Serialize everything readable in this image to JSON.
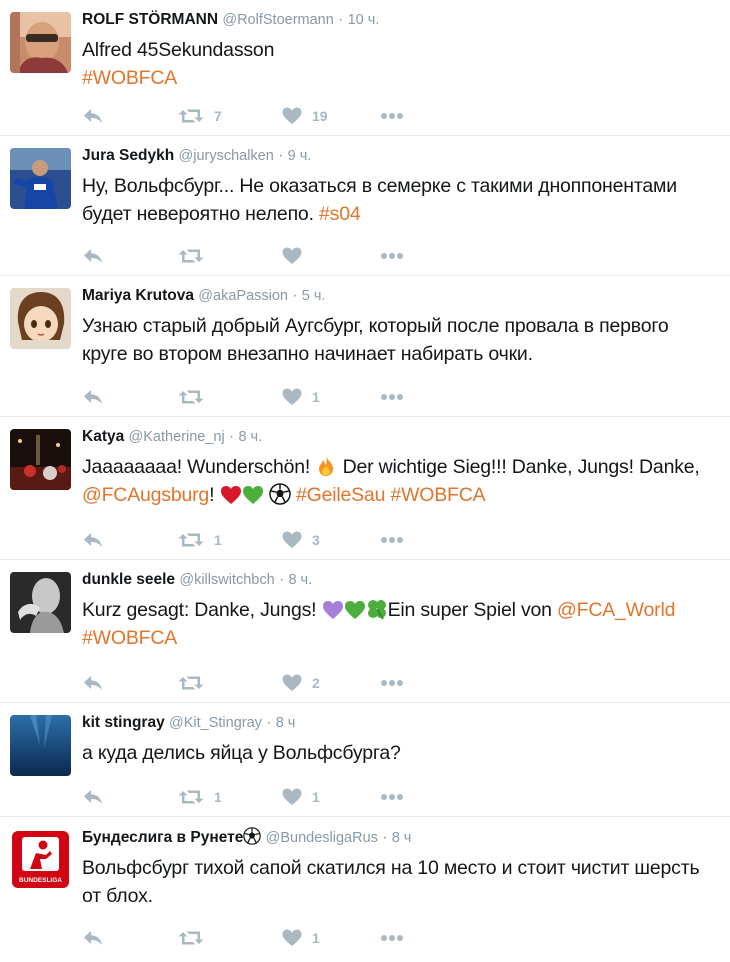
{
  "tweets": [
    {
      "name": "ROLF STÖRMANN",
      "handle": "@RolfStoermann",
      "time": "10 ч.",
      "text_plain": "Alfred 45Sekundasson",
      "hashtag": "#WOBFCA",
      "retweets": "7",
      "likes": "19"
    },
    {
      "name": "Jura Sedykh",
      "handle": "@juryschalken",
      "time": "9 ч.",
      "text_plain": "Ну, Вольфсбург... Не оказаться в семерке с такими дноппонентами будет невероятно нелепо.",
      "hashtag": "#s04",
      "retweets": "",
      "likes": ""
    },
    {
      "name": "Mariya Krutova",
      "handle": "@akaPassion",
      "time": "5 ч.",
      "text_plain": "Узнаю старый добрый Аугсбург, который после провала в первого круге во втором внезапно начинает набирать очки.",
      "retweets": "",
      "likes": "1"
    },
    {
      "name": "Katya",
      "handle": "@Katherine_nj",
      "time": "8 ч.",
      "text_part1": "Jaaaaaaaa! Wunderschön!",
      "text_part2": "Der wichtige Sieg!!! Danke, Jungs! Danke,",
      "mention": "@FCAugsburg",
      "text_part3": "!",
      "hashtag1": "#GeileSau",
      "hashtag2": "#WOBFCA",
      "retweets": "1",
      "likes": "3"
    },
    {
      "name": "dunkle seele",
      "handle": "@killswitchbch",
      "time": "8 ч.",
      "text_part1": "Kurz gesagt: Danke, Jungs!",
      "text_part2": "Ein super Spiel von",
      "mention": "@FCA_World",
      "hashtag": "#WOBFCA",
      "retweets": "",
      "likes": "2"
    },
    {
      "name": "kit stingray",
      "handle": "@Kit_Stingray",
      "time": "8 ч",
      "text_plain": "а куда делись яйца у Вольфсбурга?",
      "retweets": "1",
      "likes": "1"
    },
    {
      "name": "Бундеслига в Рунете",
      "handle": "@BundesligaRus",
      "time": "8 ч",
      "text_plain": "Вольфсбург тихой сапой скатился на 10 место и стоит чистит шерсть от блох.",
      "logo_text": "BUNDESLIGA",
      "retweets": "",
      "likes": "1"
    }
  ],
  "colors": {
    "accent": "#e0752b",
    "muted": "#8899a6",
    "icon": "#aab8c2"
  }
}
